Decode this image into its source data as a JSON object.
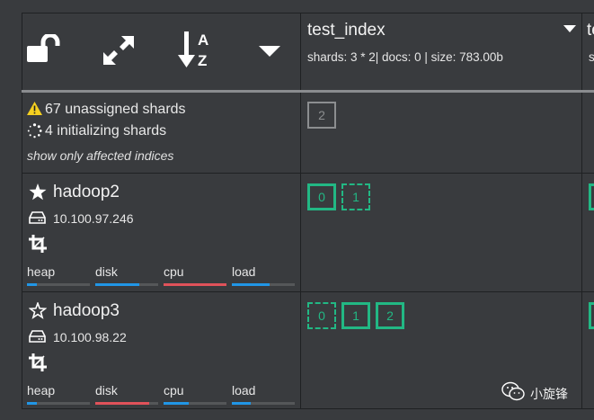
{
  "toolbar": {
    "icons": [
      "unlock-icon",
      "expand-icon",
      "sort-alpha-down-icon",
      "caret-down-icon"
    ]
  },
  "index": {
    "name": "test_index",
    "stats": "shards: 3 * 2| docs: 0 | size: 783.00b",
    "next_name_fragment": "te",
    "next_stats_fragment": "s"
  },
  "cluster_status": {
    "unassigned": "67 unassigned shards",
    "initializing": "4 initializing shards",
    "filter_link": "show only affected indices",
    "unassigned_shards": [
      "2"
    ]
  },
  "nodes": [
    {
      "name": "hadoop2",
      "ip": "10.100.97.246",
      "master": true,
      "shards": [
        {
          "label": "0",
          "state": "started"
        },
        {
          "label": "1",
          "state": "initializing"
        }
      ],
      "metrics": [
        {
          "label": "heap",
          "value": 0.15,
          "color": "#2196e6"
        },
        {
          "label": "disk",
          "value": 0.7,
          "color": "#2196e6"
        },
        {
          "label": "cpu",
          "value": 1.0,
          "color": "#e0525a"
        },
        {
          "label": "load",
          "value": 0.6,
          "color": "#2196e6"
        }
      ]
    },
    {
      "name": "hadoop3",
      "ip": "10.100.98.22",
      "master": false,
      "shards": [
        {
          "label": "0",
          "state": "initializing"
        },
        {
          "label": "1",
          "state": "started"
        },
        {
          "label": "2",
          "state": "started"
        }
      ],
      "metrics": [
        {
          "label": "heap",
          "value": 0.15,
          "color": "#2196e6"
        },
        {
          "label": "disk",
          "value": 0.85,
          "color": "#e0525a"
        },
        {
          "label": "cpu",
          "value": 0.4,
          "color": "#2196e6"
        },
        {
          "label": "load",
          "value": 0.3,
          "color": "#2196e6"
        }
      ]
    }
  ],
  "watermark": "小旋锋"
}
